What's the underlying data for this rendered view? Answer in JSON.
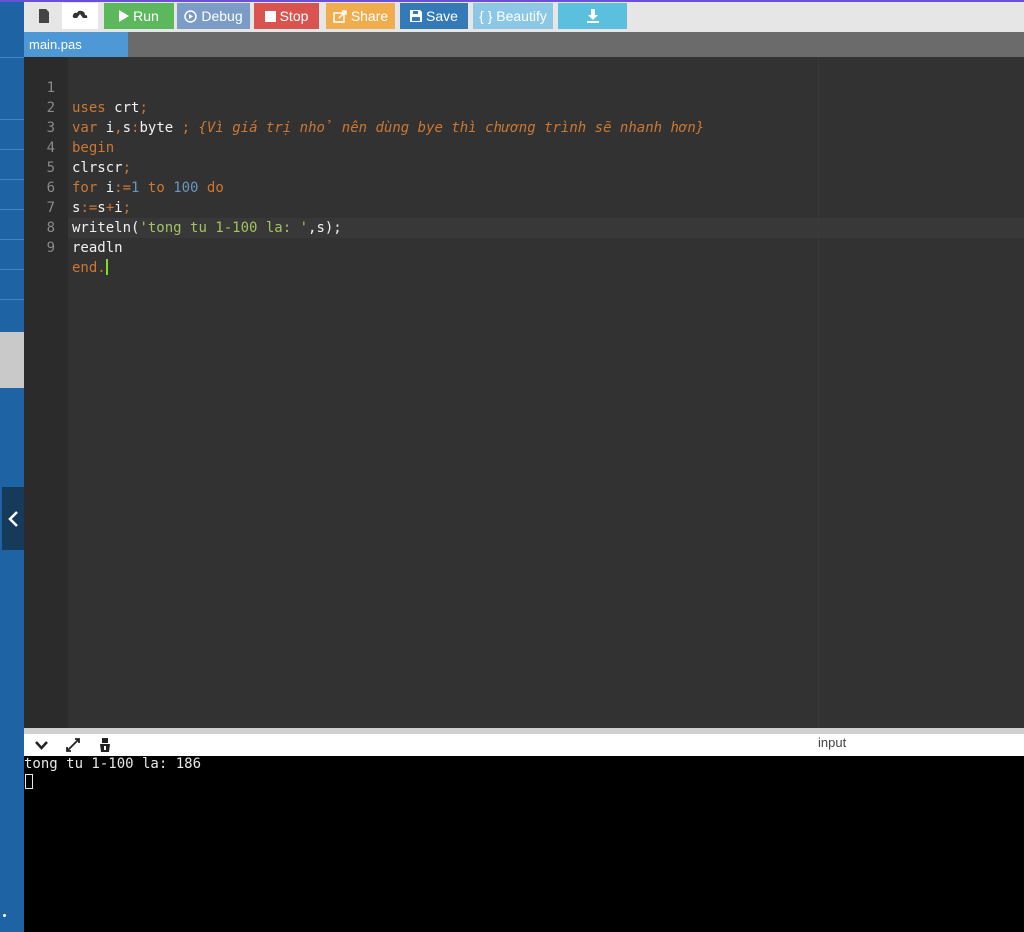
{
  "toolbar": {
    "run_label": "Run",
    "debug_label": "Debug",
    "stop_label": "Stop",
    "share_label": "Share",
    "save_label": "Save",
    "beautify_label": "{ } Beautify",
    "icons": [
      "file-icon",
      "cloud-upload-icon",
      "play-icon",
      "debug-icon",
      "stop-icon",
      "share-icon",
      "save-icon",
      "download-icon"
    ]
  },
  "tab": {
    "label": "main.pas"
  },
  "editor": {
    "line_numbers": [
      "1",
      "2",
      "3",
      "4",
      "5",
      "6",
      "7",
      "8",
      "9"
    ],
    "active_line": 9
  },
  "console": {
    "input_label": "input",
    "output": "tong tu 1-100 la: 186"
  },
  "colors": {
    "run": "#5cb85c",
    "debug": "#7a9cc6",
    "stop": "#d9534f",
    "share": "#f0ad4e",
    "save": "#337ab7",
    "beautify": "#8cc8e6",
    "download": "#5bc0de",
    "sidebar": "#1e63a3",
    "tab": "#4e98d6"
  }
}
